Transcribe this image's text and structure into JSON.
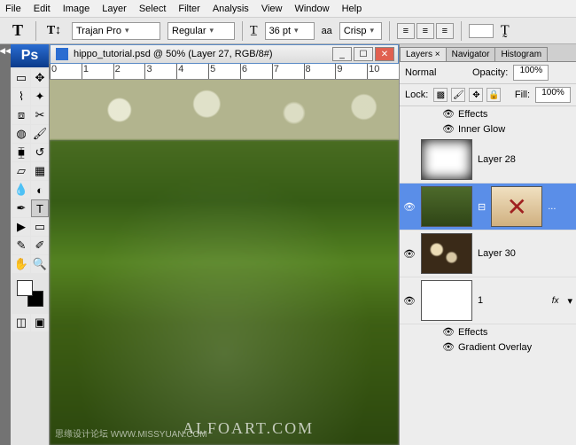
{
  "menu": {
    "items": [
      "File",
      "Edit",
      "Image",
      "Layer",
      "Select",
      "Filter",
      "Analysis",
      "View",
      "Window",
      "Help"
    ]
  },
  "options": {
    "orientation_icon": "T↕",
    "font_family": "Trajan Pro",
    "font_style": "Regular",
    "size_label": "36 pt",
    "aa_label": "aa",
    "aa_value": "Crisp"
  },
  "doc": {
    "title": "hippo_tutorial.psd @ 50% (Layer 27, RGB/8#)",
    "ruler_marks": [
      "0",
      "1",
      "2",
      "3",
      "4",
      "5",
      "6",
      "7",
      "8",
      "9",
      "10"
    ]
  },
  "panels": {
    "tabs": [
      "Layers ×",
      "Navigator",
      "Histogram"
    ],
    "blend_mode": "Normal",
    "opacity_label": "Opacity:",
    "opacity_value": "100%",
    "lock_label": "Lock:",
    "fill_label": "Fill:",
    "fill_value": "100%"
  },
  "layers": {
    "effects_label": "Effects",
    "inner_glow": "Inner Glow",
    "layer28": "Layer 28",
    "selected_more": "...",
    "layer30": "Layer 30",
    "layer1": "1",
    "fx_label": "fx",
    "gradient_overlay": "Gradient Overlay"
  },
  "watermark": {
    "text1": "思缘设计论坛 WWW.MISSYUAN.COM",
    "text2": "ALFOART.COM"
  }
}
